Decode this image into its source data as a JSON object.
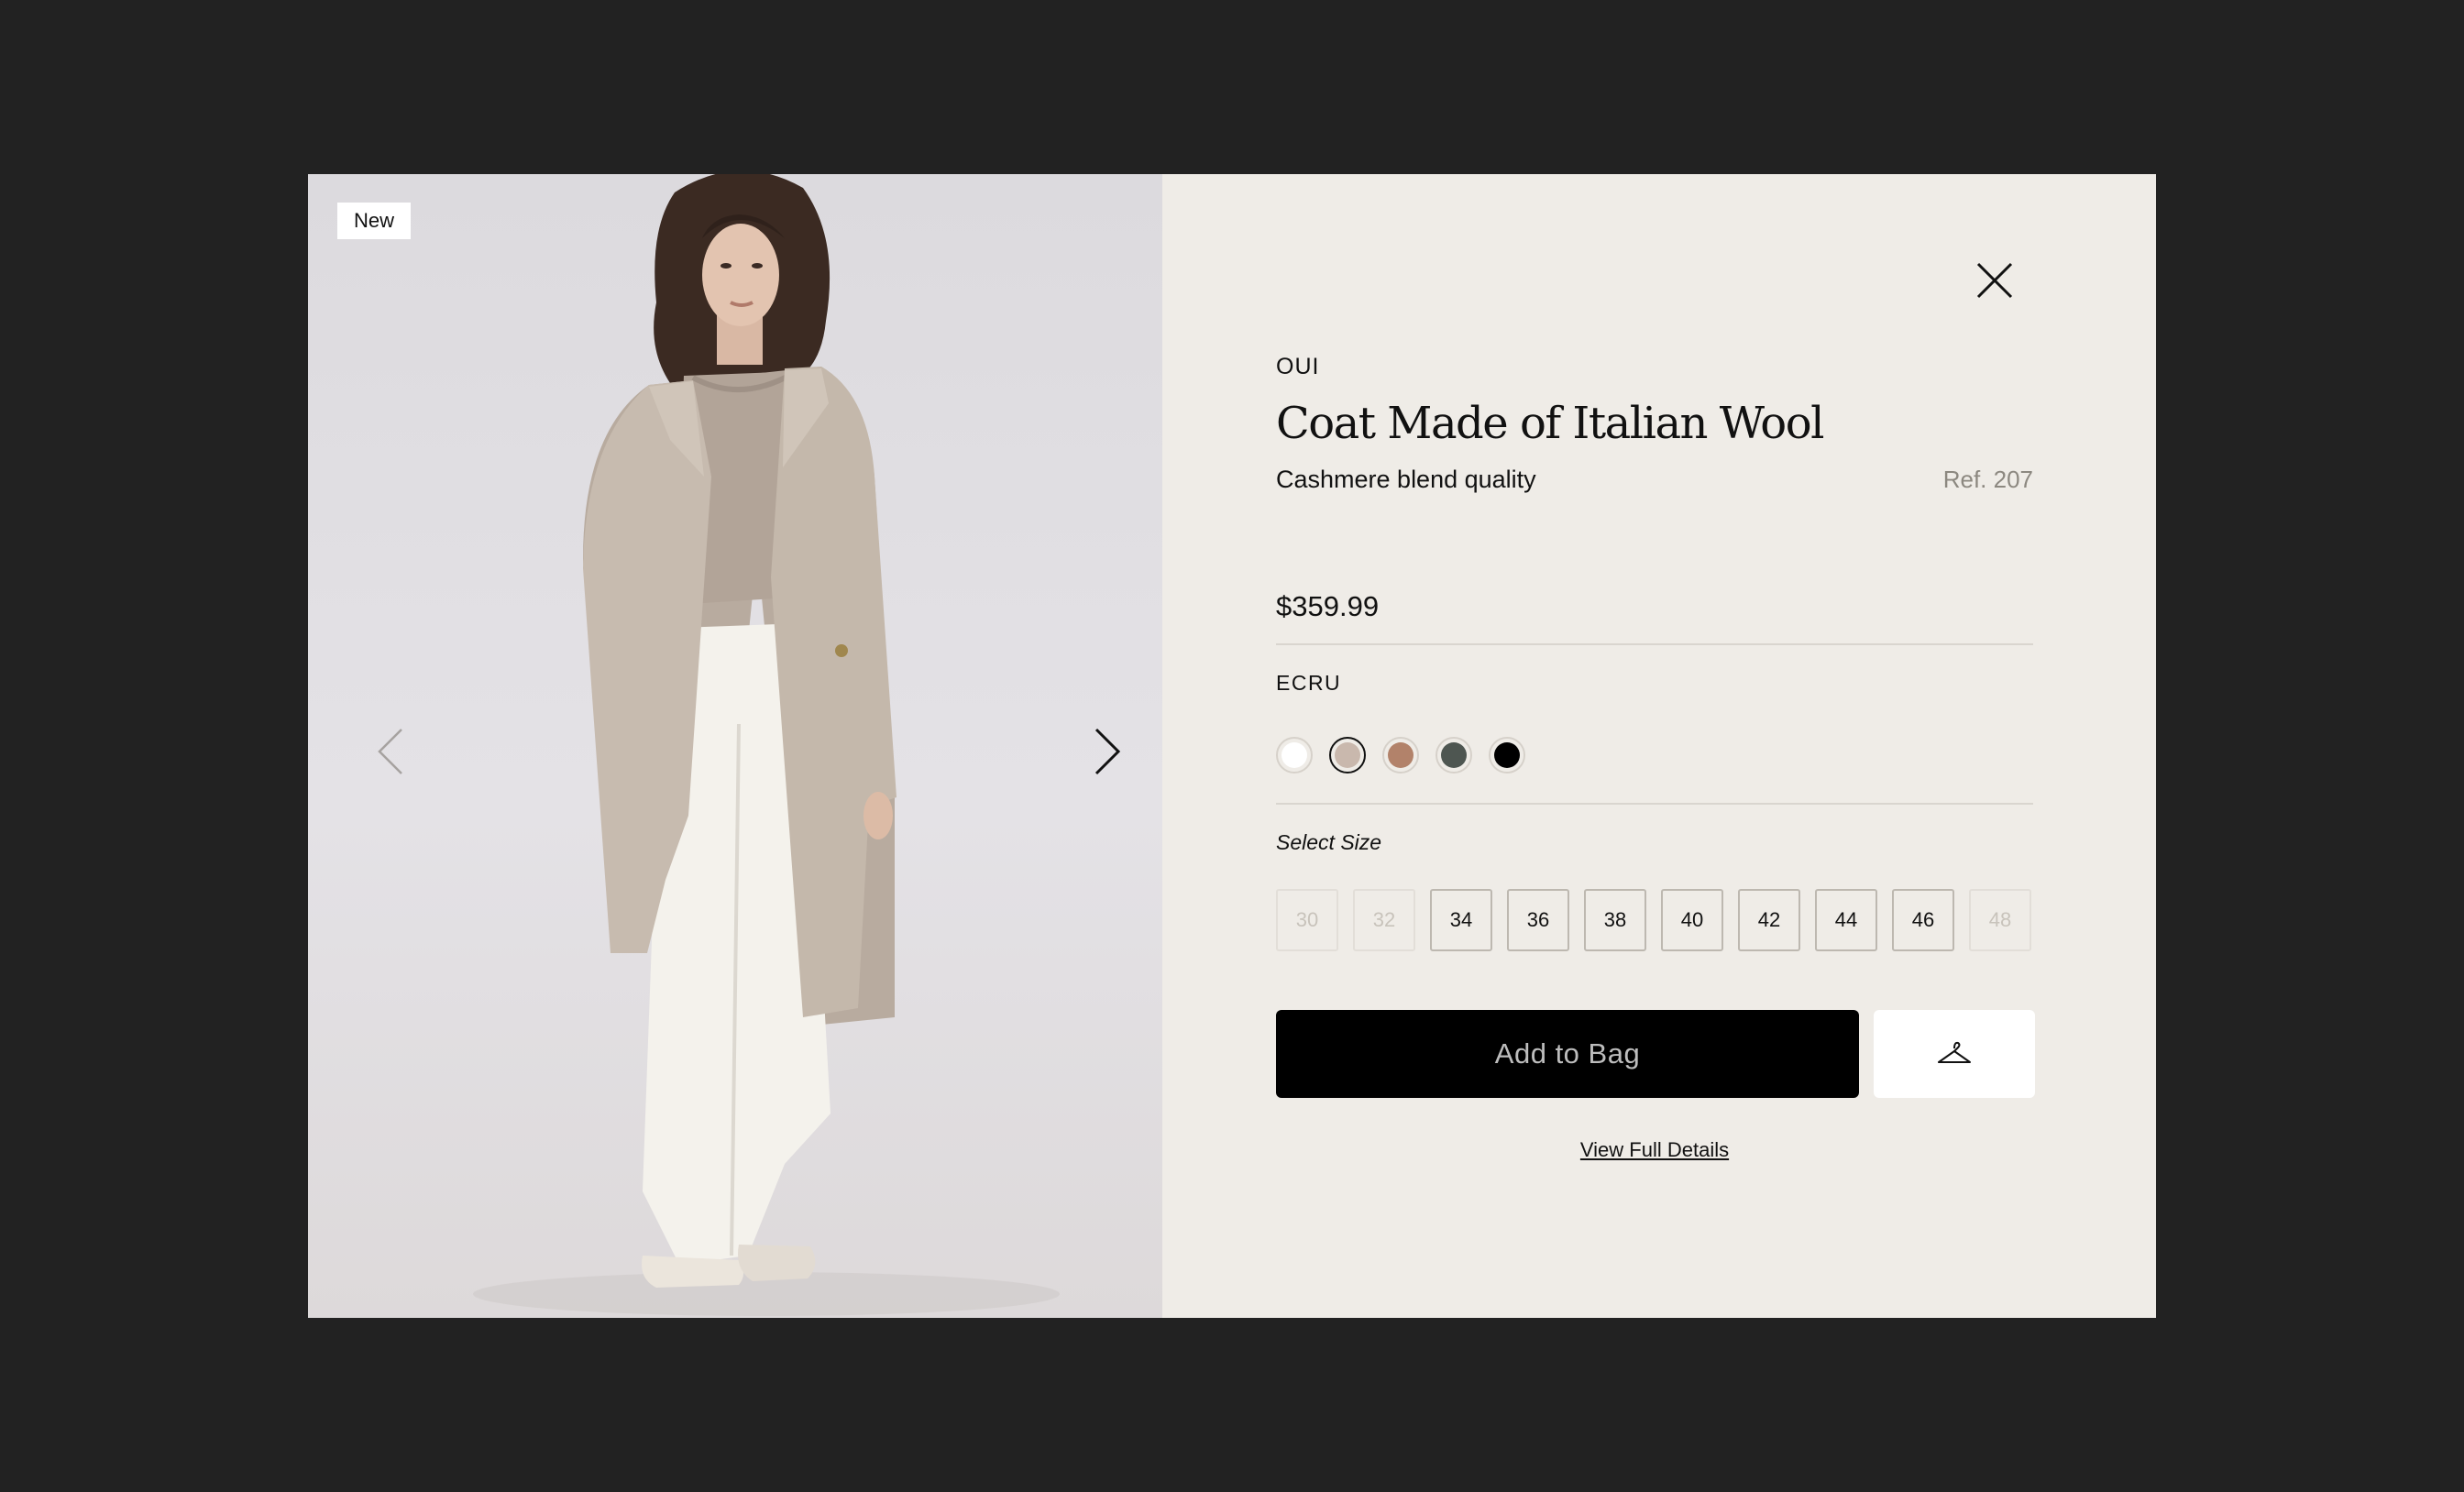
{
  "badge": "New",
  "product": {
    "brand": "OUI",
    "title": "Coat Made of Italian Wool",
    "subtitle": "Cashmere blend quality",
    "ref": "Ref. 207",
    "price": "$359.99"
  },
  "color": {
    "label": "ECRU",
    "selected_index": 1,
    "swatches": [
      {
        "name": "white",
        "hex": "#ffffff"
      },
      {
        "name": "ecru",
        "hex": "#c9b8ad"
      },
      {
        "name": "camel",
        "hex": "#b2826a"
      },
      {
        "name": "dark-green",
        "hex": "#4e5651"
      },
      {
        "name": "black",
        "hex": "#000000"
      }
    ]
  },
  "size": {
    "label": "Select Size",
    "options": [
      {
        "value": "30",
        "available": false
      },
      {
        "value": "32",
        "available": false
      },
      {
        "value": "34",
        "available": true
      },
      {
        "value": "36",
        "available": true
      },
      {
        "value": "38",
        "available": true
      },
      {
        "value": "40",
        "available": true
      },
      {
        "value": "42",
        "available": true
      },
      {
        "value": "44",
        "available": true
      },
      {
        "value": "46",
        "available": true
      },
      {
        "value": "48",
        "available": false
      }
    ]
  },
  "actions": {
    "add_to_bag": "Add to Bag",
    "wishlist_icon": "hanger-icon",
    "view_details": "View Full Details"
  },
  "icons": {
    "close": "close-icon",
    "prev": "chevron-left-icon",
    "next": "chevron-right-icon"
  }
}
